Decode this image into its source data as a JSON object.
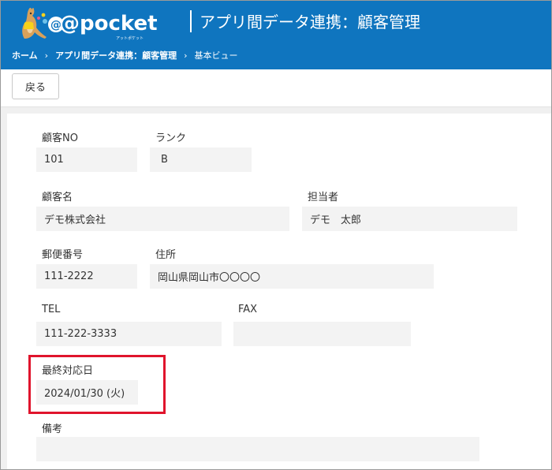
{
  "header": {
    "logo_text": "@pocket",
    "logo_sub": "アットポケット",
    "app_title": "アプリ間データ連携：顧客管理"
  },
  "breadcrumb": {
    "items": [
      "ホーム",
      "アプリ間データ連携：顧客管理",
      "基本ビュー"
    ],
    "separator": "›"
  },
  "toolbar": {
    "back_label": "戻る"
  },
  "form": {
    "customer_no": {
      "label": "顧客NO",
      "value": "101"
    },
    "rank": {
      "label": "ランク",
      "value": "B"
    },
    "customer_name": {
      "label": "顧客名",
      "value": "デモ株式会社"
    },
    "staff": {
      "label": "担当者",
      "value": "デモ　太郎"
    },
    "postal_code": {
      "label": "郵便番号",
      "value": "111-2222"
    },
    "address": {
      "label": "住所",
      "value": "岡山県岡山市〇〇〇〇"
    },
    "tel": {
      "label": "TEL",
      "value": "111-222-3333"
    },
    "fax": {
      "label": "FAX",
      "value": ""
    },
    "last_contact": {
      "label": "最終対応日",
      "value": "2024/01/30 (火)"
    },
    "notes": {
      "label": "備考",
      "value": ""
    }
  },
  "colors": {
    "header_blue": "#0f75bf",
    "highlight_red": "#e0142c",
    "field_bg": "#f3f3f3"
  },
  "icons": {
    "logo": "kangaroo-mascot-icon",
    "breadcrumb_separator": "chevron-right-icon"
  }
}
